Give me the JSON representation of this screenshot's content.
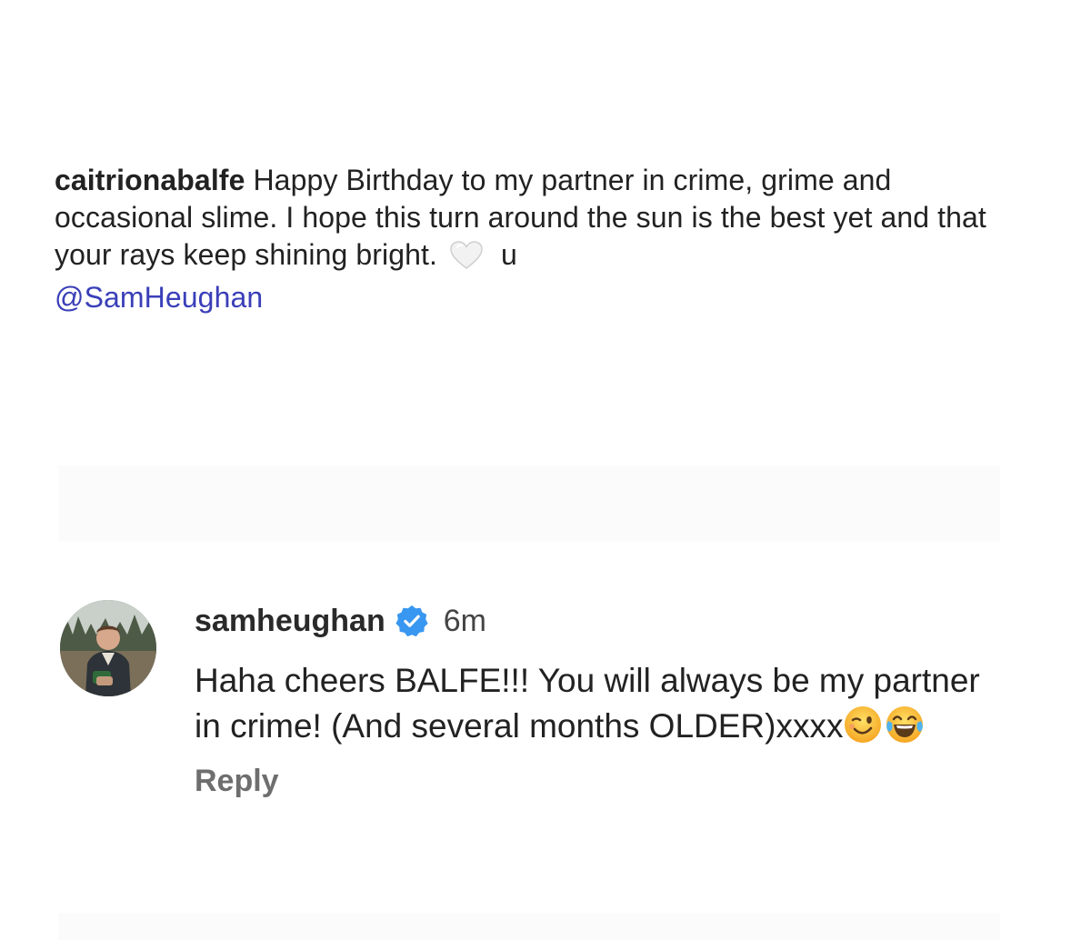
{
  "caption": {
    "username": "caitrionabalfe",
    "text": "Happy Birthday to my partner in crime, grime and occasional slime. I hope this turn around the sun is the best yet and that your rays keep shining bright.",
    "heart_icon": "white-heart-emoji",
    "after_heart": "u",
    "mention": "@SamHeughan",
    "mention_color": "#3a3fb8"
  },
  "comment": {
    "username": "samheughan",
    "verified_icon": "verified-badge-icon",
    "verified_color": "#3897f0",
    "time": "6m",
    "text": "Haha cheers BALFE!!! You will always be my partner in crime! (And several months OLDER)xxxx",
    "emojis": [
      "winking-face-emoji",
      "tears-of-joy-emoji"
    ],
    "reply_label": "Reply"
  }
}
